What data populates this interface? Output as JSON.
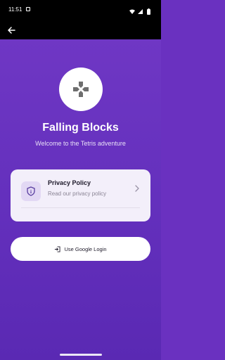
{
  "status_bar": {
    "time": "11:51"
  },
  "app": {
    "title": "Falling Blocks",
    "subtitle": "Welcome to the Tetris adventure"
  },
  "privacy_card": {
    "title": "Privacy Policy",
    "subtitle": "Read our privacy policy"
  },
  "login": {
    "label": "Use Google Login"
  },
  "colors": {
    "background": "#6a31c0",
    "card": "#f3effa",
    "accent": "#5a3fa0"
  },
  "icons": [
    "back-arrow-icon",
    "gamepad-icon",
    "shield-icon",
    "chevron-right-icon",
    "login-icon",
    "wifi-icon",
    "signal-icon",
    "battery-icon"
  ]
}
